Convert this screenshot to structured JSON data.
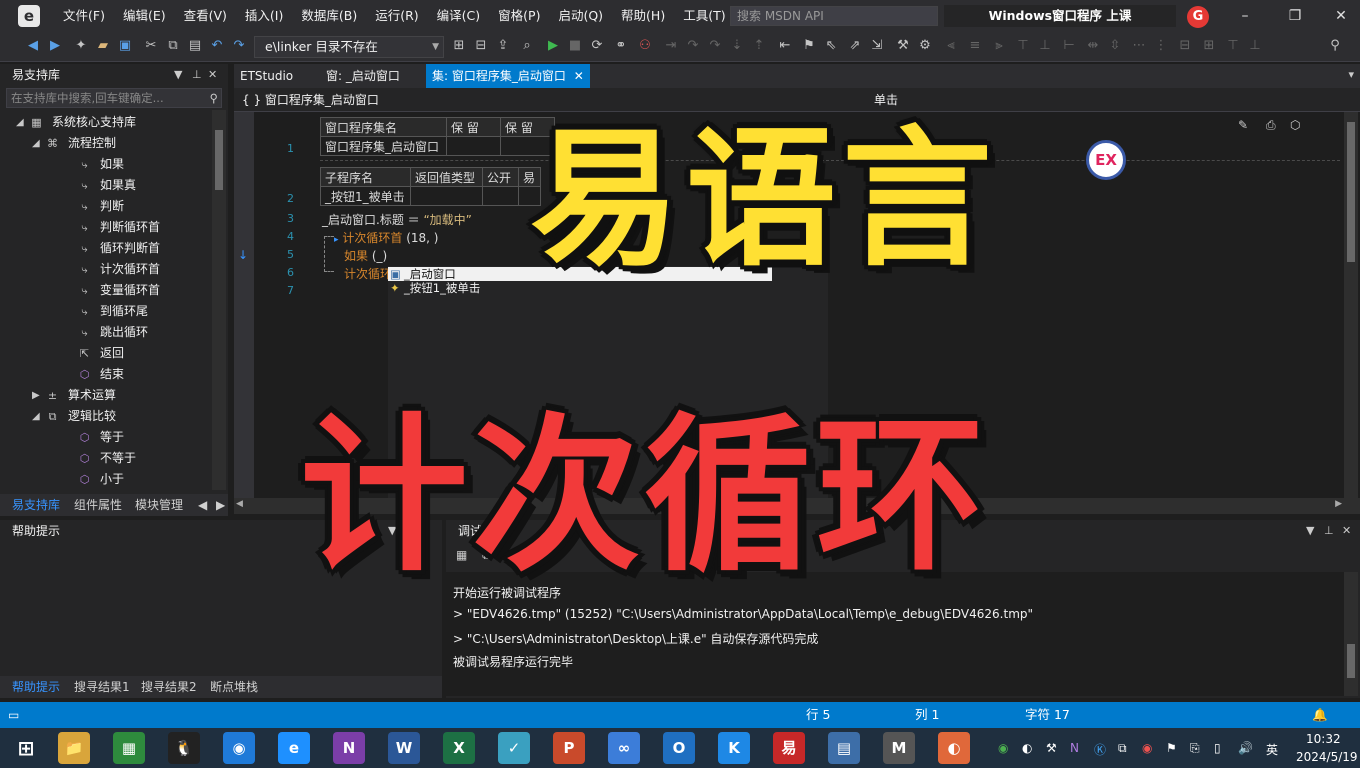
{
  "app": {
    "logo_glyph": "e",
    "menus": [
      "文件(F)",
      "编辑(E)",
      "查看(V)",
      "插入(I)",
      "数据库(B)",
      "运行(R)",
      "编译(C)",
      "窗格(P)",
      "启动(Q)",
      "帮助(H)",
      "工具(T)"
    ],
    "search_placeholder": "搜索 MSDN API",
    "window_title": "Windows窗口程序  上课",
    "badge_letter": "G",
    "window_buttons": [
      "–",
      "❐",
      "✕"
    ]
  },
  "toolbar": {
    "combo_value": "e\\linker  目录不存在"
  },
  "left_panel": {
    "title": "易支持库",
    "search_placeholder": "在支持库中搜索,回车键确定...",
    "tree": [
      {
        "label": "系统核心支持库",
        "level": 0,
        "expander": "◢",
        "icon": "▦"
      },
      {
        "label": "流程控制",
        "level": 1,
        "expander": "◢",
        "icon": "⌘"
      },
      {
        "label": "如果",
        "level": 2,
        "icon": "⤷"
      },
      {
        "label": "如果真",
        "level": 2,
        "icon": "⤷"
      },
      {
        "label": "判断",
        "level": 2,
        "icon": "⤷"
      },
      {
        "label": "判断循环首",
        "level": 2,
        "icon": "⤷"
      },
      {
        "label": "循环判断首",
        "level": 2,
        "icon": "⤷"
      },
      {
        "label": "计次循环首",
        "level": 2,
        "icon": "⤷"
      },
      {
        "label": "变量循环首",
        "level": 2,
        "icon": "⤷"
      },
      {
        "label": "到循环尾",
        "level": 2,
        "icon": "⤷"
      },
      {
        "label": "跳出循环",
        "level": 2,
        "icon": "⤷"
      },
      {
        "label": "返回",
        "level": 2,
        "icon": "⇱"
      },
      {
        "label": "结束",
        "level": 2,
        "icon": "⬡"
      },
      {
        "label": "算术运算",
        "level": 1,
        "expander": "▶",
        "icon": "±"
      },
      {
        "label": "逻辑比较",
        "level": 1,
        "expander": "◢",
        "icon": "⧉"
      },
      {
        "label": "等于",
        "level": 2,
        "icon": "⬡"
      },
      {
        "label": "不等于",
        "level": 2,
        "icon": "⬡"
      },
      {
        "label": "小于",
        "level": 2,
        "icon": "⬡"
      }
    ],
    "tabs": [
      "易支持库",
      "组件属性",
      "模块管理"
    ]
  },
  "editor": {
    "tabs": [
      "ETStudio",
      "窗: _启动窗口",
      "集: 窗口程序集_启动窗口"
    ],
    "nav_left": "{ }  窗口程序集_启动窗口",
    "nav_right": "单击",
    "table1_header": [
      "窗口程序集名",
      "保 留",
      "保 留"
    ],
    "table1_row": [
      "窗口程序集_启动窗口",
      "",
      ""
    ],
    "table2_header": [
      "子程序名",
      "返回值类型",
      "公开",
      "易"
    ],
    "table2_row": [
      "_按钮1_被单击",
      "",
      "",
      ""
    ],
    "line_numbers": [
      "1",
      "2",
      "3",
      "4",
      "5",
      "6",
      "7"
    ],
    "code_line3_a": "_启动窗口",
    "code_line3_b": ".标题 ＝ ",
    "code_line3_str": "“加载中”",
    "code_line4_kw": "计次循环首",
    "code_line4_rest": " (18, )",
    "code_line5_kw": "如果",
    "code_line5_rest": " (_)",
    "code_line6_kw": "计次循环",
    "autocomplete": [
      "_启动窗口",
      "_按钮1_被单击"
    ]
  },
  "help_panel": {
    "title": "帮助提示",
    "tabs": [
      "帮助提示",
      "搜寻结果1",
      "搜寻结果2",
      "断点堆栈"
    ]
  },
  "debug_panel": {
    "title": "调试输出",
    "lines": [
      "开始运行被调试程序",
      "> \"EDV4626.tmp\" (15252) \"C:\\Users\\Administrator\\AppData\\Local\\Temp\\e_debug\\EDV4626.tmp\"",
      "> \"C:\\Users\\Administrator\\Desktop\\上课.e\" 自动保存源代码完成",
      "被调试易程序运行完毕"
    ]
  },
  "status": {
    "row": "行 5",
    "col": "列 1",
    "chars": "字符 17"
  },
  "taskbar": {
    "apps": [
      {
        "glyph": "📁",
        "color": "#d9a53b"
      },
      {
        "glyph": "▦",
        "color": "#2e8b3d"
      },
      {
        "glyph": "🐧",
        "color": "#222222"
      },
      {
        "glyph": "◉",
        "color": "#1f7ad8"
      },
      {
        "glyph": "e",
        "color": "#1e90ff"
      },
      {
        "glyph": "N",
        "color": "#7b3ea8"
      },
      {
        "glyph": "W",
        "color": "#2b5797"
      },
      {
        "glyph": "X",
        "color": "#1d7044"
      },
      {
        "glyph": "✓",
        "color": "#3aa0c0"
      },
      {
        "glyph": "P",
        "color": "#c94a2b"
      },
      {
        "glyph": "∞",
        "color": "#3c7dd9"
      },
      {
        "glyph": "O",
        "color": "#1f6fc1"
      },
      {
        "glyph": "K",
        "color": "#1e88e5"
      },
      {
        "glyph": "易",
        "color": "#c62828"
      },
      {
        "glyph": "▤",
        "color": "#3d6ea8"
      },
      {
        "glyph": "M",
        "color": "#555555"
      },
      {
        "glyph": "◐",
        "color": "#e0683a"
      }
    ],
    "tray_lang": "英",
    "time": "10:32",
    "date": "2024/5/19"
  },
  "overlay": {
    "line1": "易语言",
    "line2": "计次循环",
    "badge": "EX"
  },
  "colors": {
    "accent": "#007acc",
    "overlay_yellow": "#ffe033",
    "overlay_red": "#f23a3a",
    "keyword_orange": "#d7862c"
  }
}
